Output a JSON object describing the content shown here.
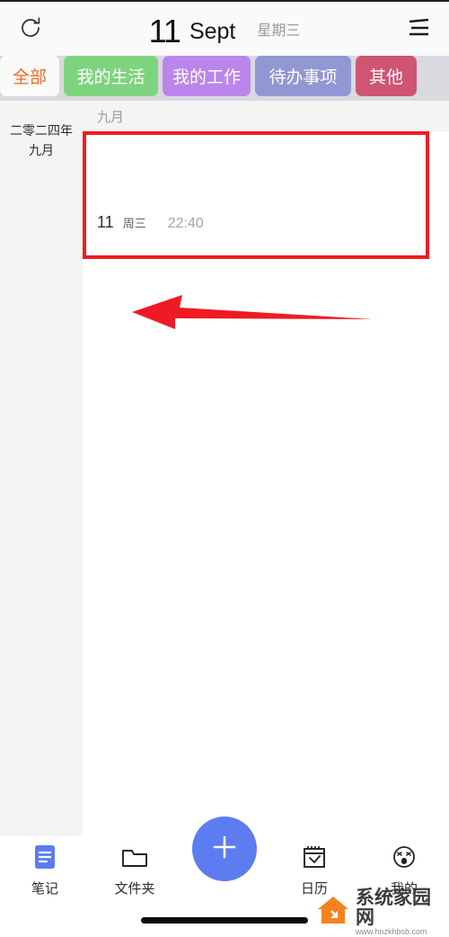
{
  "header": {
    "refresh_icon": "refresh-icon",
    "day_number": "11",
    "month_label": "Sept",
    "weekday_label": "星期三",
    "menu_icon": "hamburger-menu-icon"
  },
  "chips": {
    "items": [
      {
        "label": "全部",
        "color": "#fafaf8",
        "text_color": "#f1682c",
        "active": true
      },
      {
        "label": "我的生活",
        "color": "#7ed47e",
        "text_color": "#ffffff",
        "active": false
      },
      {
        "label": "我的工作",
        "color": "#bb86ec",
        "text_color": "#ffffff",
        "active": false
      },
      {
        "label": "待办事项",
        "color": "#9197d2",
        "text_color": "#ffffff",
        "active": false
      },
      {
        "label": "其他",
        "color": "#cf5572",
        "text_color": "#ffffff",
        "active": false
      }
    ]
  },
  "sidebar": {
    "year_label": "二零二四年",
    "month_label": "九月"
  },
  "content": {
    "month_header": "九月",
    "note": {
      "day": "11",
      "weekday": "周三",
      "time": "22:40",
      "body": ""
    }
  },
  "annotations": {
    "box_color": "#f01b21",
    "arrow_color": "#ee1b24",
    "arrow_direction": "left"
  },
  "bottom_nav": {
    "items": [
      {
        "label": "笔记",
        "icon": "notes-icon",
        "active": true
      },
      {
        "label": "文件夹",
        "icon": "folder-icon",
        "active": false
      },
      {
        "label": "日历",
        "icon": "calendar-icon",
        "active": false
      },
      {
        "label": "我的",
        "icon": "profile-face-icon",
        "active": false
      }
    ],
    "fab": {
      "icon": "plus-icon",
      "color": "#5c7cf0"
    }
  },
  "watermark": {
    "title": "系统家园网",
    "url": "www.hnzkhbsb.com",
    "logo_color": "#f5821f"
  }
}
